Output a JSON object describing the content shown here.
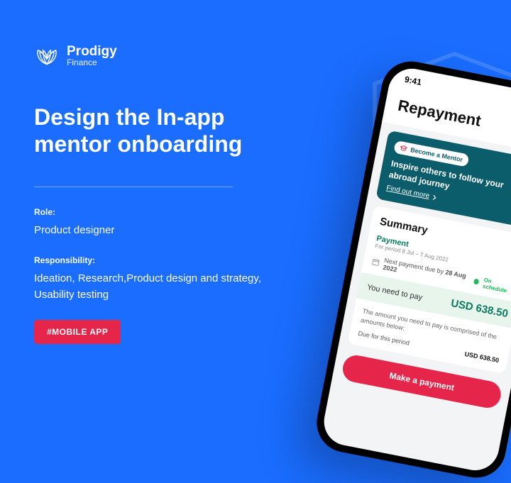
{
  "brand": {
    "name": "Prodigy",
    "sub": "Finance"
  },
  "headline": "Design the In-app mentor onboarding",
  "role": {
    "label": "Role:",
    "value": "Product designer"
  },
  "responsibility": {
    "label": "Responsibility:",
    "value": "Ideation, Research,Product design and strategy, Usability testing"
  },
  "tag": "#MOBILE APP",
  "phone": {
    "time": "9:41",
    "header": "Repayment",
    "mentor": {
      "badge": "Become a Mentor",
      "title": "Inspire others to follow your abroad journey",
      "link": "Find out more"
    },
    "summary": {
      "title": "Summary",
      "payment_label": "Payment",
      "period": "For period 8 Jul – 7 Aug 2022",
      "next_prefix": "Next payment due by ",
      "next_date": "28 Aug 2022",
      "on_schedule": "On schedule",
      "need_label": "You need to pay",
      "need_amount": "USD 638.50",
      "detail": "The amount you need to pay is comprised of the amounts below:",
      "due_label": "Due for this period",
      "due_amount": "USD 638.50"
    },
    "cta": "Make a payment"
  }
}
